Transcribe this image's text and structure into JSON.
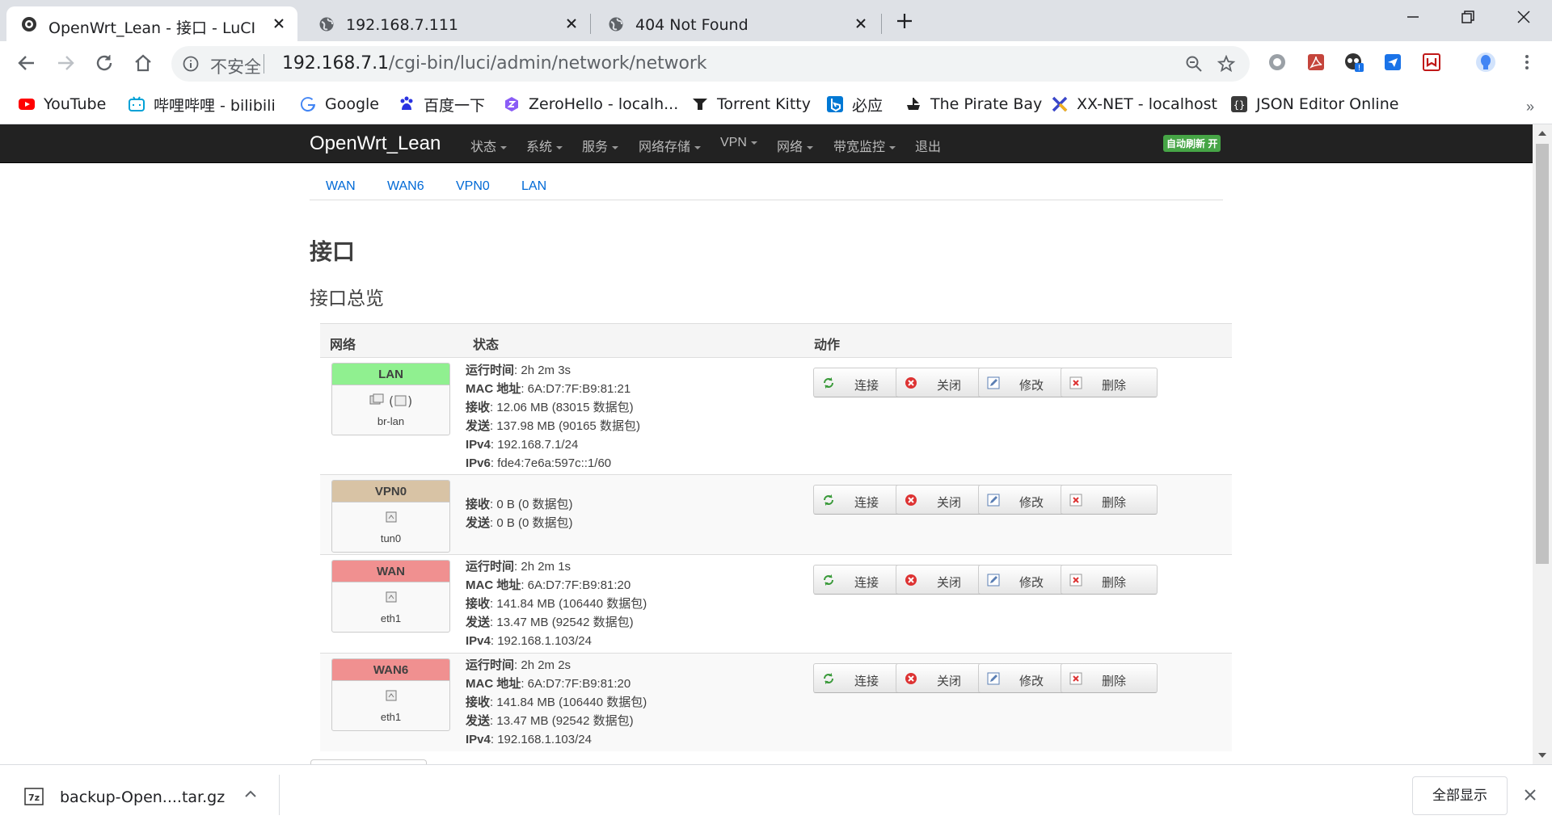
{
  "browser": {
    "tabs": [
      {
        "title": "OpenWrt_Lean - 接口 - LuCI",
        "active": true,
        "icon": "openwrt-favicon-icon"
      },
      {
        "title": "192.168.7.111",
        "active": false,
        "icon": "globe-icon"
      },
      {
        "title": "404 Not Found",
        "active": false,
        "icon": "globe-icon"
      }
    ],
    "address": {
      "insecure_label": "不安全",
      "url_host": "192.168.7.1",
      "url_path": "/cgi-bin/luci/admin/network/network"
    },
    "bookmarks": [
      {
        "label": "YouTube",
        "icon": "youtube-icon"
      },
      {
        "label": "哔哩哔哩 - bilibili",
        "icon": "bilibili-icon"
      },
      {
        "label": "Google",
        "icon": "google-icon"
      },
      {
        "label": "百度一下",
        "icon": "baidu-icon"
      },
      {
        "label": "ZeroHello - localh...",
        "icon": "zeronet-icon"
      },
      {
        "label": "Torrent Kitty",
        "icon": "torrent-kitty-icon"
      },
      {
        "label": "必应",
        "icon": "bing-icon"
      },
      {
        "label": "The Pirate Bay",
        "icon": "pirate-bay-icon"
      },
      {
        "label": "XX-NET - localhost",
        "icon": "xx-net-icon"
      },
      {
        "label": "JSON Editor Online",
        "icon": "json-editor-icon"
      }
    ],
    "bookmarks_more": "»"
  },
  "luci": {
    "brand": "OpenWrt_Lean",
    "menu": [
      "状态",
      "系统",
      "服务",
      "网络存储",
      "VPN",
      "网络",
      "带宽监控",
      "退出"
    ],
    "auto_refresh": "自动刷新 开",
    "subtabs": [
      "WAN",
      "WAN6",
      "VPN0",
      "LAN"
    ],
    "page_title": "接口",
    "section_title": "接口总览",
    "table_headers": {
      "network": "网络",
      "status": "状态",
      "actions": "动作"
    },
    "action_labels": {
      "connect": "连接",
      "stop": "关闭",
      "edit": "修改",
      "delete": "删除"
    },
    "interfaces": [
      {
        "name": "LAN",
        "device": "br-lan",
        "color": "#90f090",
        "status": [
          {
            "k": "运行时间",
            "v": ": 2h 2m 3s"
          },
          {
            "k": "MAC 地址",
            "v": ": 6A:D7:7F:B9:81:21"
          },
          {
            "k": "接收",
            "v": ": 12.06 MB (83015 数据包)"
          },
          {
            "k": "发送",
            "v": ": 137.98 MB (90165 数据包)"
          },
          {
            "k": "IPv4",
            "v": ": 192.168.7.1/24"
          },
          {
            "k": "IPv6",
            "v": ": fde4:7e6a:597c::1/60"
          }
        ]
      },
      {
        "name": "VPN0",
        "device": "tun0",
        "color": "#d8c3a5",
        "status": [
          {
            "k": "接收",
            "v": ": 0 B (0 数据包)"
          },
          {
            "k": "发送",
            "v": ": 0 B (0 数据包)"
          }
        ]
      },
      {
        "name": "WAN",
        "device": "eth1",
        "color": "#f09090",
        "status": [
          {
            "k": "运行时间",
            "v": ": 2h 2m 1s"
          },
          {
            "k": "MAC 地址",
            "v": ": 6A:D7:7F:B9:81:20"
          },
          {
            "k": "接收",
            "v": ": 141.84 MB (106440 数据包)"
          },
          {
            "k": "发送",
            "v": ": 13.47 MB (92542 数据包)"
          },
          {
            "k": "IPv4",
            "v": ": 192.168.1.103/24"
          }
        ]
      },
      {
        "name": "WAN6",
        "device": "eth1",
        "color": "#f09090",
        "status": [
          {
            "k": "运行时间",
            "v": ": 2h 2m 2s"
          },
          {
            "k": "MAC 地址",
            "v": ": 6A:D7:7F:B9:81:20"
          },
          {
            "k": "接收",
            "v": ": 141.84 MB (106440 数据包)"
          },
          {
            "k": "发送",
            "v": ": 13.47 MB (92542 数据包)"
          },
          {
            "k": "IPv4",
            "v": ": 192.168.1.103/24"
          }
        ]
      }
    ]
  },
  "download": {
    "filename": "backup-Open....tar.gz",
    "show_all": "全部显示"
  }
}
